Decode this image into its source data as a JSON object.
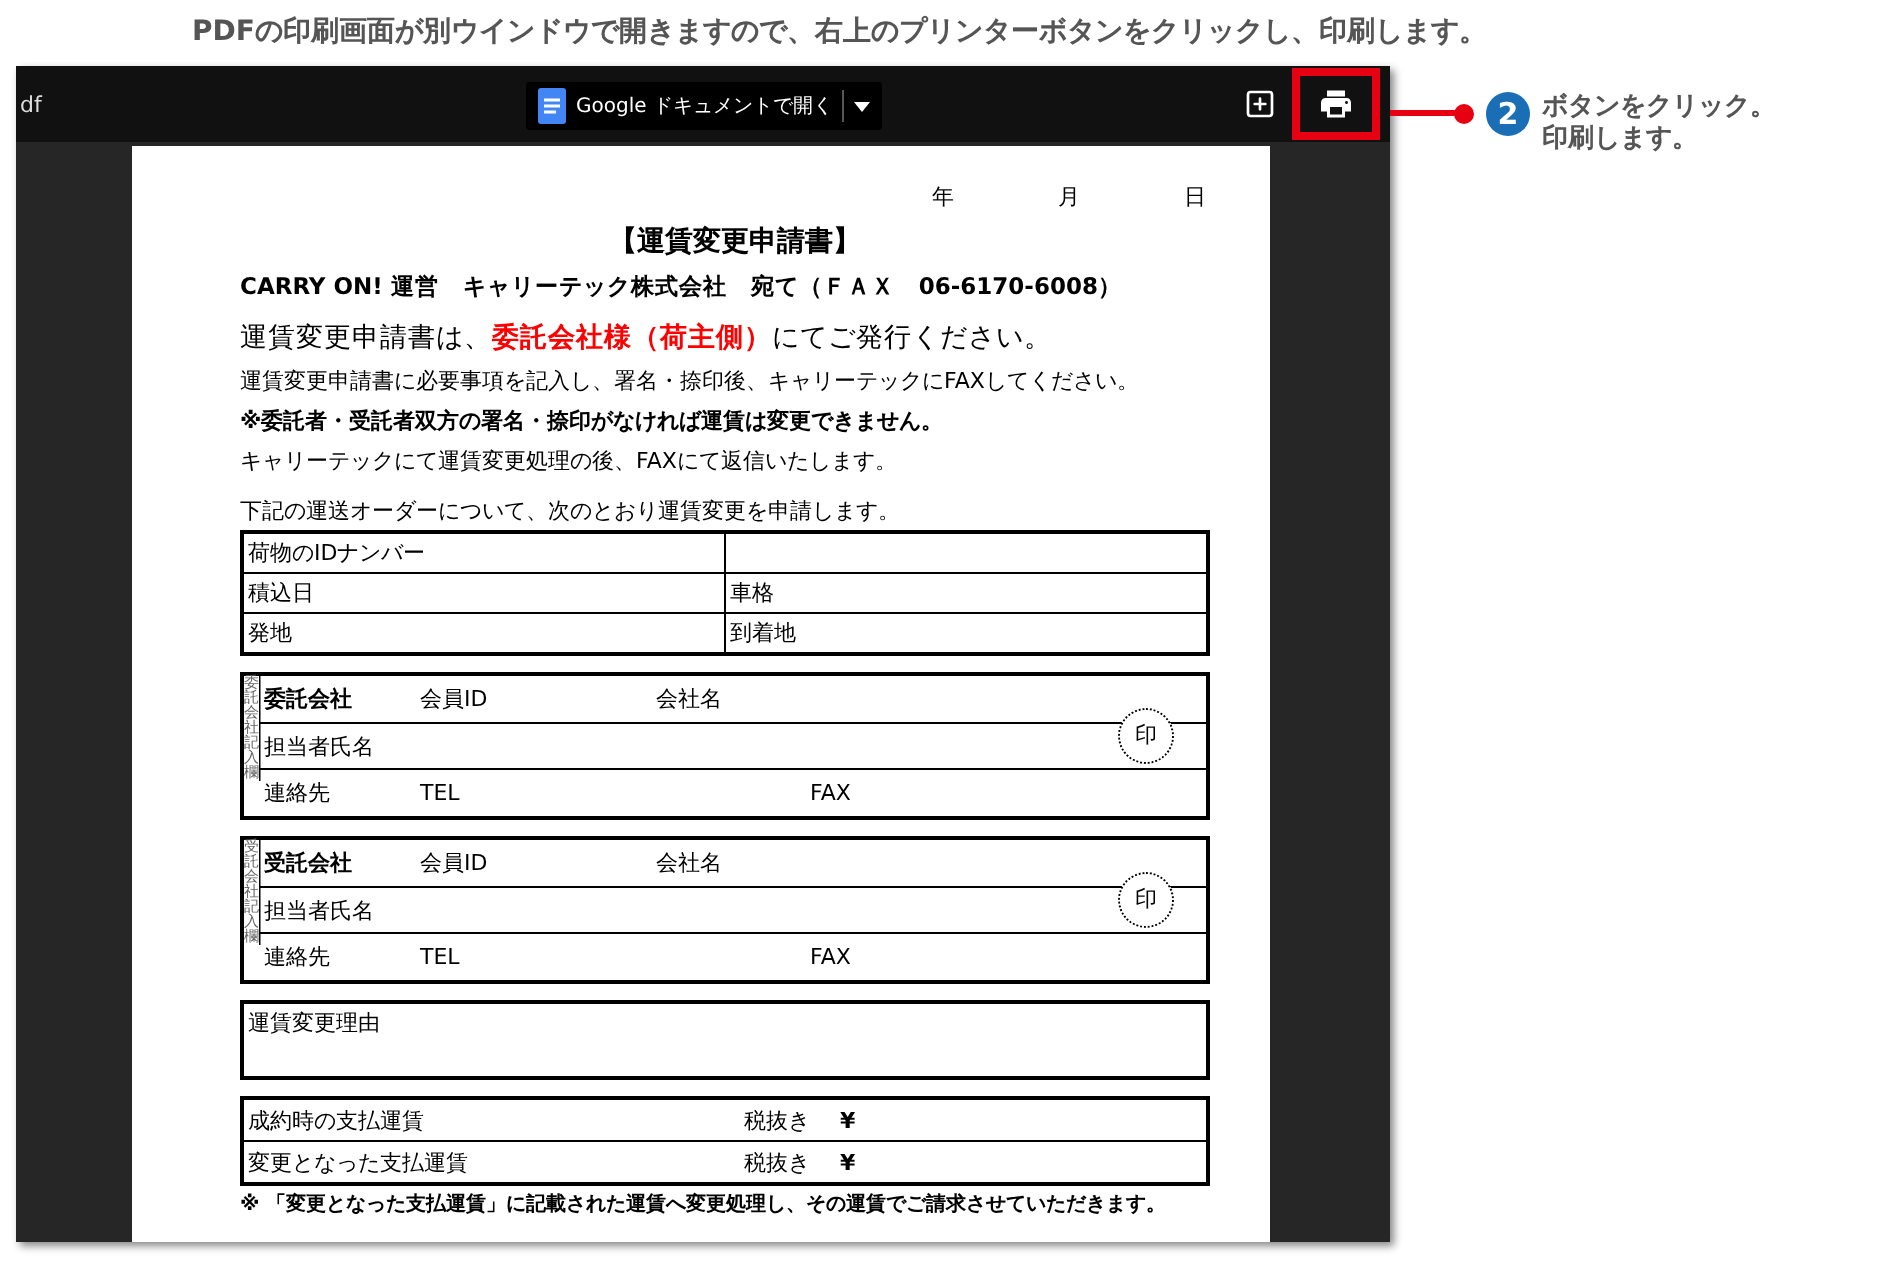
{
  "instruction": "PDFの印刷画面が別ウインドウで開きますので、右上のプリンターボタンをクリックし、印刷します。",
  "viewer": {
    "filename_fragment": "df",
    "open_button": "Google ドキュメントで開く",
    "print_highlighted": true
  },
  "callout": {
    "step": "2",
    "lines": [
      "ボタンをクリック。",
      "印刷します。"
    ]
  },
  "document": {
    "date_labels": [
      "年",
      "月",
      "日"
    ],
    "title": "【運賃変更申請書】",
    "addressee": "CARRY ON! 運営　キャリーテック株式会社　宛て（ＦＡＸ　06-6170-6008）",
    "intro": "運賃変更申請書は、**委託会社様（荷主側）**にてご発行ください。",
    "notes": [
      {
        "text": "運賃変更申請書に必要事項を記入し、署名・捺印後、キャリーテックにFAXしてください。",
        "kind": "plain"
      },
      {
        "text": "※委託者・受託者双方の署名・捺印がなければ運賃は変更できません。",
        "kind": "bold"
      },
      {
        "text": "キャリーテックにて運賃変更処理の後、FAXにて返信いたします。",
        "kind": "plain"
      }
    ],
    "order_lead": "下記の運送オーダーについて、次のとおり運賃変更を申請します。",
    "order_rows": [
      {
        "left": "荷物のIDナンバー"
      },
      {
        "left": "積込日",
        "right": "車格"
      },
      {
        "left": "発地",
        "right": "到着地"
      }
    ],
    "parties": [
      {
        "side_label": "委託会社記入欄",
        "name": "委託会社",
        "member_id": "会員ID",
        "company": "会社名",
        "person": "担当者氏名",
        "seal": "印",
        "contact": "連絡先",
        "tel": "TEL",
        "fax": "FAX"
      },
      {
        "side_label": "受託会社記入欄",
        "name": "受託会社",
        "member_id": "会員ID",
        "company": "会社名",
        "person": "担当者氏名",
        "seal": "印",
        "contact": "連絡先",
        "tel": "TEL",
        "fax": "FAX"
      }
    ],
    "reason": "運賃変更理由",
    "fares": [
      {
        "label": "成約時の支払運賃",
        "tax": "税抜き",
        "yen": "¥"
      },
      {
        "label": "変更となった支払運賃",
        "tax": "税抜き",
        "yen": "¥"
      }
    ],
    "footnote": "※ 「変更となった支払運賃」に記載された運賃へ変更処理し、その運賃でご請求させていただきます。"
  }
}
